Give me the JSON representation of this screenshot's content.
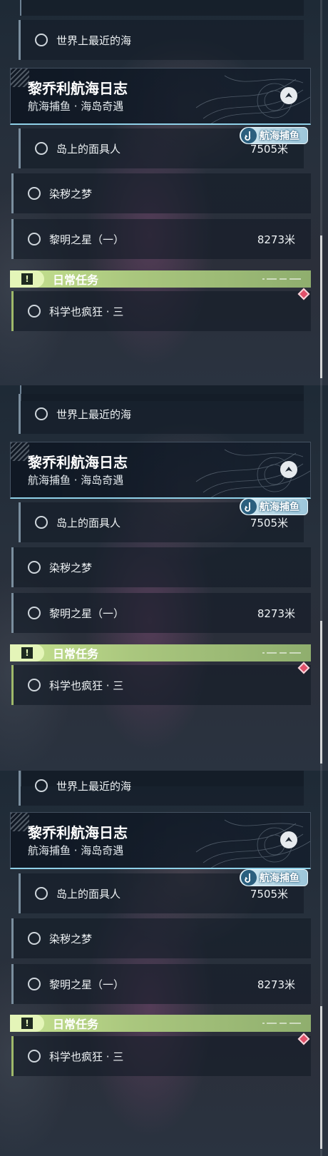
{
  "frames": [
    {
      "quests_top": {
        "label": "世界上最近的海"
      },
      "header": {
        "title": "黎乔利航海日志",
        "subtitle": "航海捕鱼 · 海岛奇遇"
      },
      "tag": {
        "icon": "fishing-hook-icon",
        "label": "航海捕鱼"
      },
      "quests": [
        {
          "label": "岛上的面具人",
          "distance": "7505米"
        },
        {
          "label": "染秽之梦",
          "distance": ""
        },
        {
          "label": "黎明之星（一）",
          "distance": "8273米"
        }
      ],
      "daily": {
        "title": "日常任务",
        "icon": "exclamation-icon",
        "quest": {
          "label": "科学也疯狂 · 三"
        }
      }
    },
    {
      "quests_top": {
        "label": "世界上最近的海"
      },
      "header": {
        "title": "黎乔利航海日志",
        "subtitle": "航海捕鱼 · 海岛奇遇"
      },
      "tag": {
        "icon": "fishing-hook-icon",
        "label": "航海捕鱼"
      },
      "quests": [
        {
          "label": "岛上的面具人",
          "distance": "7505米"
        },
        {
          "label": "染秽之梦",
          "distance": ""
        },
        {
          "label": "黎明之星（一）",
          "distance": "8273米"
        }
      ],
      "daily": {
        "title": "日常任务",
        "icon": "exclamation-icon",
        "quest": {
          "label": "科学也疯狂 · 三"
        }
      }
    },
    {
      "quests_top": {
        "label": "世界上最近的海"
      },
      "header": {
        "title": "黎乔利航海日志",
        "subtitle": "航海捕鱼 · 海岛奇遇"
      },
      "tag": {
        "icon": "fishing-hook-icon",
        "label": "航海捕鱼"
      },
      "quests": [
        {
          "label": "岛上的面具人",
          "distance": "7505米"
        },
        {
          "label": "染秽之梦",
          "distance": ""
        },
        {
          "label": "黎明之星（一）",
          "distance": "8273米"
        }
      ],
      "daily": {
        "title": "日常任务",
        "icon": "exclamation-icon",
        "quest": {
          "label": "科学也疯狂 · 三"
        }
      }
    }
  ],
  "colors": {
    "daily_accent": "#aac77e",
    "header_underline": "#8fd0e8",
    "alert_diamond": "#e0506a"
  }
}
